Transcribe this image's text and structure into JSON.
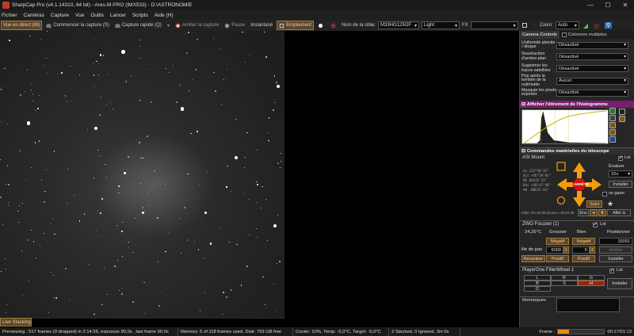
{
  "window": {
    "title": "SharpCap Pro (v4.1.14310, 64 bit) - Ares-M PRO (IMX533) - D:\\ASTRONOMIE",
    "minimize": "—",
    "maximize": "☐",
    "close": "✕"
  },
  "menu": [
    "Fichier",
    "Caméras",
    "Capture",
    "Vue",
    "Outils",
    "Lancer",
    "Scripts",
    "Aide (H)"
  ],
  "toolbar": {
    "live_view": "Vue en direct (W)",
    "start_capture": "Commencer la capture (S)",
    "quick_capture": "Capture rapide (Q)",
    "stop_capture": "Arrêter la capture",
    "pause": "Pause",
    "snapshot": "Instantané",
    "stacking": "Empilement",
    "target_label": "Nom de la cible:",
    "target_value": "M33HG125OF",
    "frame_type": "Light",
    "fx_label": "FX",
    "fx_value": "",
    "zoom_label": "Zoom:",
    "zoom_value": "Auto"
  },
  "live_stacking_tab": "Live Stacking",
  "status": {
    "previewing": "Previewing : 517 frames (0 dropped) in 2:14:56, exposure 90,0s , last frame 90,0s",
    "memory": "Memory: 5 of 118 frames used. Disk: 793 GB free",
    "cooler": "Cooler: 10%, Temp: -5,0°C, Target: -5,0°C",
    "stacked": "2 Stacked, 0 Ignored, 3m 0s",
    "frame_label": "Frame :",
    "frame_time": "00:17/01:13",
    "frame_progress": 0.23
  },
  "panel": {
    "tab_controls": "Camera Controls",
    "tab_multi": "Colonnes multiples",
    "options": [
      {
        "label": "Uniformité pleinite / disque",
        "value": "Désactivé"
      },
      {
        "label": "Soustraction d'arrière-plan",
        "value": "Désactivé"
      },
      {
        "label": "Supprimer les traces satellites",
        "value": "Désactivé"
      },
      {
        "label": "Pop après la tombée de la nuit/matin",
        "value": "Aucun"
      },
      {
        "label": "Masquer les pixels exposés",
        "value": "Désactivé"
      }
    ],
    "histogram_title": "Afficher l'étirement de l'histogramme",
    "telescope_title": "Commandes matérielles du télescope",
    "mount": {
      "name": "ASI Mount",
      "linked_label": "Lié",
      "evaluate_label": "Évaluer",
      "rate": "32x",
      "install_btn": "Installer",
      "stop_btn": "ARRÊTE",
      "park_label": "se garer",
      "follow_btn": "Suivi",
      "goto_btn": "Aller à",
      "coords": [
        {
          "k": "Az",
          "v": "123°50'42\""
        },
        {
          "k": "ALt",
          "v": "+56°59'01\""
        },
        {
          "k": "RA",
          "v": "01h35'22\""
        },
        {
          "k": "Déc",
          "v": "+30°47'46\""
        },
        {
          "k": "AH",
          "v": "-00h52'01\""
        }
      ],
      "cible": "Cible: RA=01:35:22,Dec=+30:47:46",
      "ens_btn": "Ens"
    },
    "focuser": {
      "name": "ZWO Focuser (1)",
      "linked_label": "Lié",
      "temp": "24,25°C",
      "coarse": "Grossier",
      "fine": "Bien",
      "position_label": "Positionner",
      "neg1": "Négatif",
      "neg2": "Négatif",
      "position_value": "15091",
      "step_label": "ille de pas",
      "step_coarse": "6000",
      "step_fine": "5",
      "stop_btn": "Arrêter",
      "recenter": "Recentrer",
      "pos1": "Positif",
      "pos2": "Positif",
      "install_btn": "Installer"
    },
    "filterwheel": {
      "name": "PlayerOne FilterWheel 1",
      "linked_label": "Lié",
      "filters": [
        "L",
        "R",
        "G",
        "B",
        "S",
        "H",
        "O"
      ],
      "selected": "H",
      "install_btn": "Installer"
    },
    "remarks_label": "Remarques"
  }
}
